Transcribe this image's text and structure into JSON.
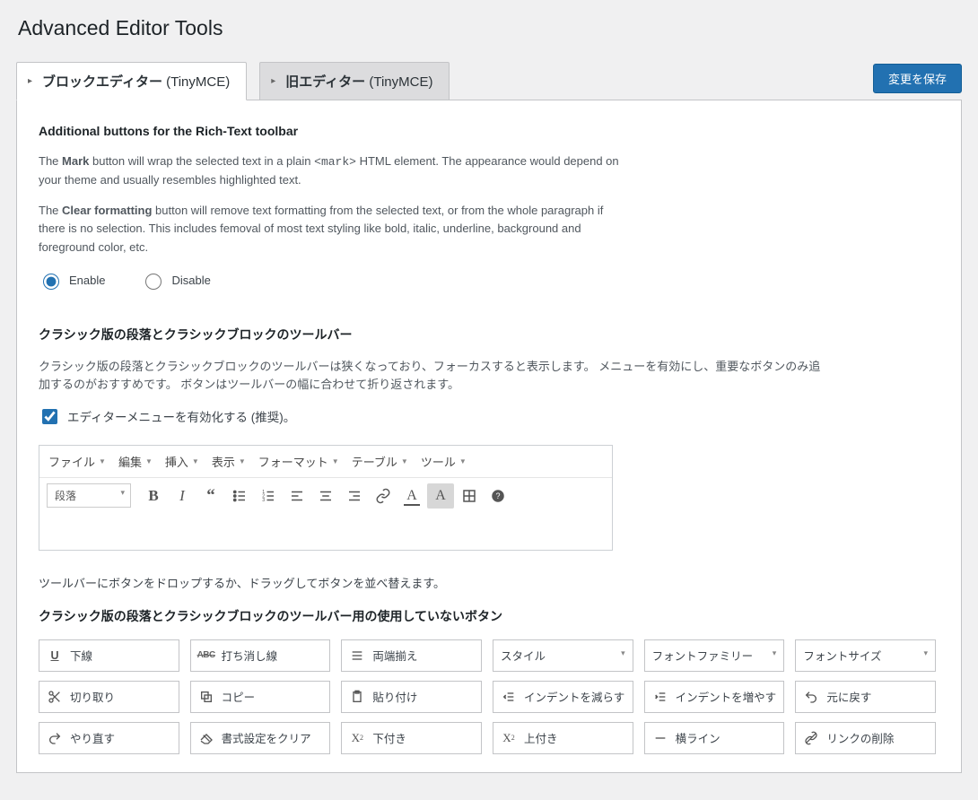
{
  "page": {
    "title": "Advanced Editor Tools",
    "save_button": "変更を保存"
  },
  "tabs": {
    "block": {
      "label_bold": "ブロックエディター",
      "label_paren": " (TinyMCE)"
    },
    "classic": {
      "label_bold": "旧エディター",
      "label_paren": " (TinyMCE)"
    }
  },
  "section1": {
    "title": "Additional buttons for the Rich-Text toolbar",
    "p1a": "The ",
    "p1b": "Mark",
    "p1c": " button will wrap the selected text in a plain ",
    "p1code": "<mark>",
    "p1d": " HTML element. The appearance would depend on your theme and usually resembles highlighted text.",
    "p2a": "The ",
    "p2b": "Clear formatting",
    "p2c": " button will remove text formatting from the selected text, or from the whole paragraph if there is no selection. This includes femoval of most text styling like bold, italic, underline, background and foreground color, etc.",
    "radio_enable": "Enable",
    "radio_disable": "Disable"
  },
  "section2": {
    "title": "クラシック版の段落とクラシックブロックのツールバー",
    "p1": "クラシック版の段落とクラシックブロックのツールバーは狭くなっており、フォーカスすると表示します。 メニューを有効にし、重要なボタンのみ追加するのがおすすめです。 ボタンはツールバーの幅に合わせて折り返されます。",
    "chk_label": "エディターメニューを有効化する (推奨)。"
  },
  "menubar": {
    "file": "ファイル",
    "edit": "編集",
    "insert": "挿入",
    "view": "表示",
    "format": "フォーマット",
    "table": "テーブル",
    "tools": "ツール"
  },
  "toolbar": {
    "format_select": "段落"
  },
  "hint": "ツールバーにボタンをドロップするか、ドラッグしてボタンを並べ替えます。",
  "section3": {
    "title": "クラシック版の段落とクラシックブロックのツールバー用の使用していないボタン"
  },
  "unused": {
    "underline": "下線",
    "strike": "打ち消し線",
    "justify": "両端揃え",
    "style": "スタイル",
    "fontfamily": "フォントファミリー",
    "fontsize": "フォントサイズ",
    "cut": "切り取り",
    "copy": "コピー",
    "paste": "貼り付け",
    "outdent": "インデントを減らす",
    "indent": "インデントを増やす",
    "undo": "元に戻す",
    "redo": "やり直す",
    "clearfmt": "書式設定をクリア",
    "subscript": "下付き",
    "superscript": "上付き",
    "hr": "横ライン",
    "unlink": "リンクの削除"
  }
}
